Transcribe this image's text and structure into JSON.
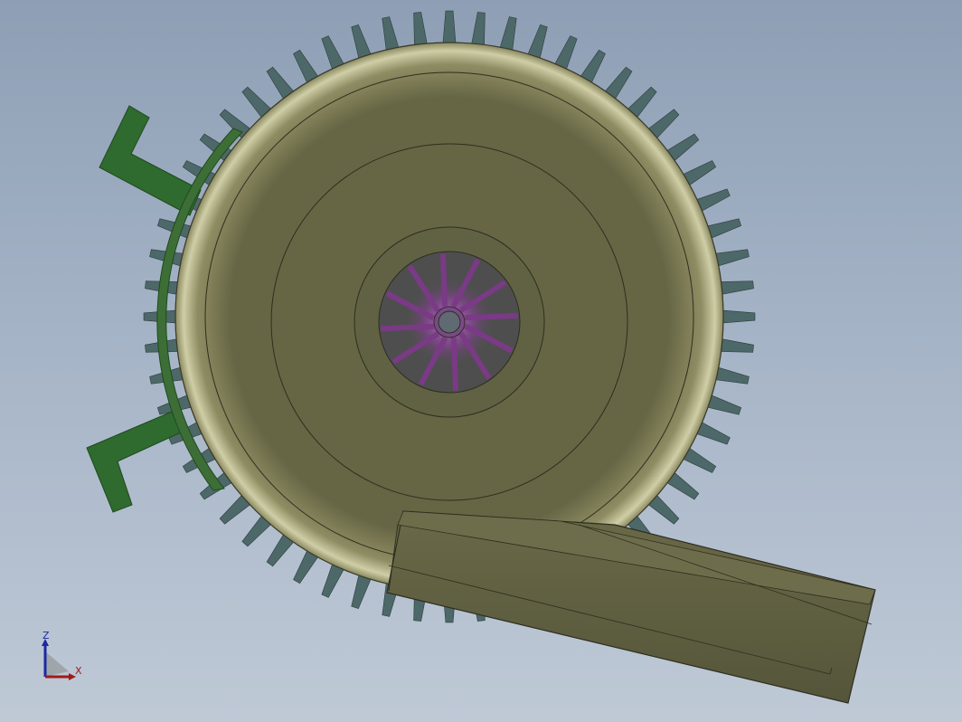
{
  "viewport": {
    "model": "centrifugal-blower-assembly",
    "background_top": "#8e9fb5",
    "background_bottom": "#bfc9d6",
    "colors": {
      "housing": "#6b6a48",
      "housing_light": "#c2c19a",
      "housing_dark": "#55553a",
      "outlet_duct": "#5d5c3f",
      "motor_fins": "#4d6868",
      "mount_bracket": "#2f6a2e",
      "impeller_blades": "#7a3a86",
      "impeller_glow": "#c060d8",
      "hub": "#5f6a72",
      "cooling_ring": "#7a4a40"
    },
    "fin_count": 60
  },
  "triad": {
    "z_label": "Z",
    "x_label": "X",
    "z_color": "#1a2aa0",
    "x_color": "#a01a1a"
  }
}
